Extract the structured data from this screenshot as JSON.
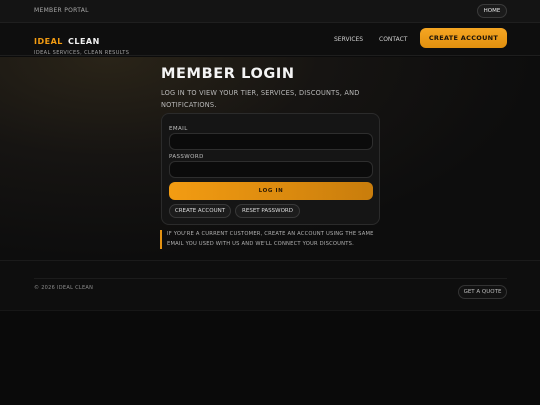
{
  "topbar": {
    "portal": "MEMBER PORTAL",
    "home": "HOME"
  },
  "brand": {
    "part1": "IDEAL",
    "part2": "CLEAN",
    "tagline": "IDEAL SERVICES, CLEAN RESULTS"
  },
  "nav": {
    "services": "SERVICES",
    "contact": "CONTACT",
    "create_account": "CREATE ACCOUNT"
  },
  "hero": {
    "title": "MEMBER LOGIN",
    "subtitle": "LOG IN TO VIEW YOUR TIER, SERVICES, DISCOUNTS, AND NOTIFICATIONS."
  },
  "form": {
    "email_label": "EMAIL",
    "email_value": "",
    "password_label": "PASSWORD",
    "password_value": "",
    "login_button": "LOG IN",
    "create_account": "CREATE ACCOUNT",
    "reset_password": "RESET PASSWORD"
  },
  "notice": "IF YOU'RE A CURRENT CUSTOMER, CREATE AN ACCOUNT USING THE SAME EMAIL YOU USED WITH US AND WE'LL CONNECT YOUR DISCOUNTS.",
  "footer": {
    "copyright": "© 2026 IDEAL CLEAN",
    "quote": "GET A QUOTE"
  },
  "colors": {
    "accent": "#f39c12",
    "background": "#0b0b0b",
    "card": "#151515"
  }
}
